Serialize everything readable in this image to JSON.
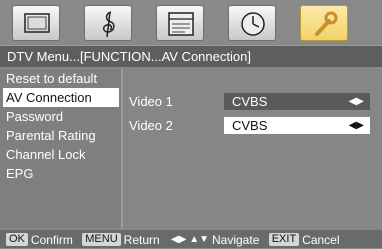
{
  "icon_tabs": [
    {
      "icon": "tv-screen-icon",
      "active": false
    },
    {
      "icon": "treble-clef-icon",
      "active": false
    },
    {
      "icon": "calendar-icon",
      "active": false
    },
    {
      "icon": "clock-icon",
      "active": false
    },
    {
      "icon": "wrench-icon",
      "active": true
    }
  ],
  "title": "DTV Menu...[FUNCTION...AV Connection]",
  "menu": {
    "items": [
      {
        "label": "Reset to default",
        "selected": false
      },
      {
        "label": "AV Connection",
        "selected": true
      },
      {
        "label": "Password",
        "selected": false
      },
      {
        "label": "Parental Rating",
        "selected": false
      },
      {
        "label": "Channel Lock",
        "selected": false
      },
      {
        "label": "EPG",
        "selected": false
      }
    ]
  },
  "settings": [
    {
      "label": "Video 1",
      "value": "CVBS",
      "focused": false
    },
    {
      "label": "Video 2",
      "value": "CVBS",
      "focused": true
    }
  ],
  "footer": {
    "ok_key": "OK",
    "ok_text": "Confirm",
    "menu_key": "MENU",
    "menu_text": "Return",
    "nav_glyphs": "◀▶ ▲▼",
    "nav_text": "Navigate",
    "exit_key": "EXIT",
    "exit_text": "Cancel"
  },
  "colors": {
    "background": "#888888",
    "title_bar": "#5e5e5e",
    "selection": "#ffffff",
    "active_tab": "#f2d36a"
  }
}
